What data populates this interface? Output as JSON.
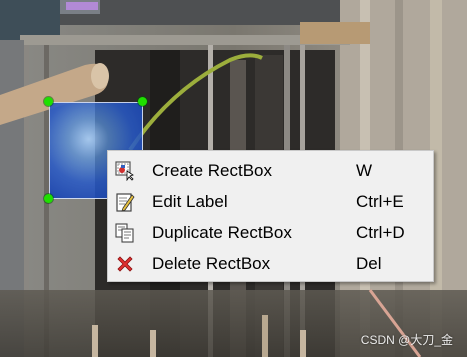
{
  "context_menu": {
    "items": [
      {
        "label": "Create RectBox",
        "shortcut": "W",
        "icon": "create-rectbox-icon"
      },
      {
        "label": "Edit Label",
        "shortcut": "Ctrl+E",
        "icon": "edit-label-icon"
      },
      {
        "label": "Duplicate RectBox",
        "shortcut": "Ctrl+D",
        "icon": "duplicate-icon"
      },
      {
        "label": "Delete RectBox",
        "shortcut": "Del",
        "icon": "delete-icon"
      }
    ]
  },
  "watermark": {
    "text": "CSDN @大刀_金"
  },
  "colors": {
    "handle": "#1fe000",
    "box_fill": "#2f6fd8",
    "menu_bg": "#f0f0f0",
    "delete_icon": "#e03030"
  }
}
